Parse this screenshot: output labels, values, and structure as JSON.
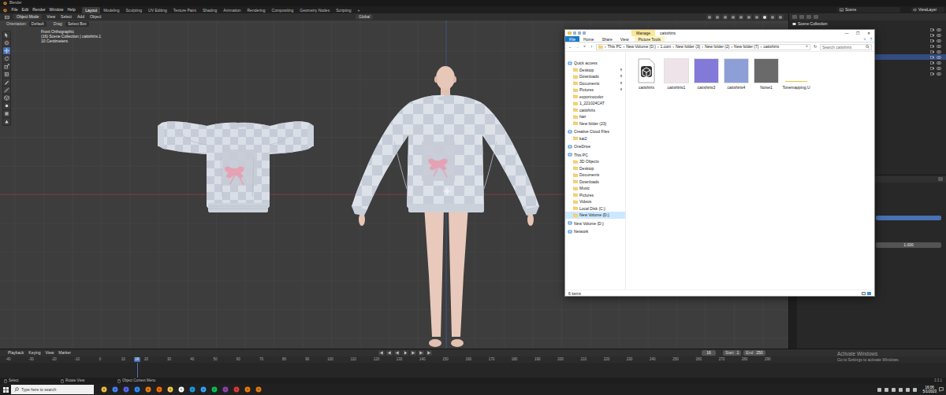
{
  "blender": {
    "title": "Blender",
    "menu": [
      "File",
      "Edit",
      "Render",
      "Window",
      "Help"
    ],
    "workspaces": [
      {
        "label": "Layout",
        "selected": true
      },
      {
        "label": "Modeling",
        "selected": false
      },
      {
        "label": "Sculpting",
        "selected": false
      },
      {
        "label": "UV Editing",
        "selected": false
      },
      {
        "label": "Texture Paint",
        "selected": false
      },
      {
        "label": "Shading",
        "selected": false
      },
      {
        "label": "Animation",
        "selected": false
      },
      {
        "label": "Rendering",
        "selected": false
      },
      {
        "label": "Compositing",
        "selected": false
      },
      {
        "label": "Geometry Nodes",
        "selected": false
      },
      {
        "label": "Scripting",
        "selected": false
      }
    ],
    "add_workspace": "+",
    "scene": "Scene",
    "view_layer": "ViewLayer",
    "header": {
      "mode": "Object Mode",
      "menus": [
        "View",
        "Select",
        "Add",
        "Object"
      ],
      "transform": "Global"
    },
    "tool_settings": {
      "orientation_label": "Orientation:",
      "orientation": "Default",
      "drag_label": "Drag:",
      "drag": "Select Box"
    },
    "viewport": {
      "info": [
        "Front Orthographic",
        "(16) Scene Collection | cattshirts.1",
        "10 Centimeters"
      ]
    },
    "tools": [
      {
        "selected": false
      },
      {
        "selected": false
      },
      {
        "selected": true
      },
      {
        "selected": false
      },
      {
        "selected": false
      },
      {
        "selected": false
      },
      {
        "selected": false
      },
      {
        "selected": false
      },
      {
        "selected": false
      },
      {
        "selected": false
      },
      {
        "selected": false
      },
      {
        "selected": false
      }
    ],
    "outliner": {
      "title": "Scene Collection",
      "rows": [
        {
          "selected": false
        },
        {
          "selected": false
        },
        {
          "selected": false
        },
        {
          "selected": false
        },
        {
          "selected": false
        },
        {
          "selected": true
        },
        {
          "selected": false
        },
        {
          "selected": false
        },
        {
          "selected": false
        }
      ]
    },
    "properties": {
      "value": "1.000"
    },
    "timeline": {
      "menus": [
        "Playback",
        "Keying",
        "View",
        "Marker"
      ],
      "current_frame": "16",
      "start_label": "Start",
      "start": "1",
      "end_label": "End",
      "end": "250",
      "ruler": [
        "-40",
        "-30",
        "-20",
        "-10",
        "0",
        "10",
        "20",
        "30",
        "40",
        "50",
        "60",
        "70",
        "80",
        "90",
        "100",
        "110",
        "120",
        "130",
        "140",
        "150",
        "160",
        "170",
        "180",
        "190",
        "200",
        "210",
        "220",
        "230",
        "240",
        "250",
        "260",
        "270",
        "280",
        "290"
      ]
    },
    "status_bar": {
      "items": [
        "Select",
        "Rotate View",
        "Object Context Menu"
      ],
      "version": "3.3.1"
    }
  },
  "explorer": {
    "title": "cattshirts",
    "context_tab": "Manage",
    "window_controls": [
      "—",
      "☐",
      "✕"
    ],
    "ribbon_tabs": [
      {
        "label": "File",
        "kind": "file"
      },
      {
        "label": "Home",
        "kind": "tab"
      },
      {
        "label": "Share",
        "kind": "tab"
      },
      {
        "label": "View",
        "kind": "tab"
      },
      {
        "label": "Picture Tools",
        "kind": "contextual"
      }
    ],
    "ribbon_right": [
      "˅",
      "?"
    ],
    "nav_buttons": [
      "←",
      "→",
      "˅",
      "↑"
    ],
    "address": {
      "path": [
        "This PC",
        "New Volume (D:)",
        "1.com",
        "New folder (3)",
        "New folder (2)",
        "New folder (7)",
        "cattshirts"
      ],
      "separator": "›",
      "dropdown": "˅",
      "refresh": "↻"
    },
    "search": {
      "placeholder": "Search cattshirts"
    },
    "nav": [
      {
        "label": "Quick access",
        "kind": "group",
        "selected": false,
        "pinned": false
      },
      {
        "label": "Desktop",
        "kind": "item",
        "selected": false,
        "pinned": true
      },
      {
        "label": "Downloads",
        "kind": "item",
        "selected": false,
        "pinned": true
      },
      {
        "label": "Documents",
        "kind": "item",
        "selected": false,
        "pinned": true
      },
      {
        "label": "Pictures",
        "kind": "item",
        "selected": false,
        "pinned": true
      },
      {
        "label": "exportnocolor",
        "kind": "item",
        "selected": false,
        "pinned": false
      },
      {
        "label": "1_221024CAT",
        "kind": "item",
        "selected": false,
        "pinned": false
      },
      {
        "label": "cattshirts",
        "kind": "item",
        "selected": false,
        "pinned": false
      },
      {
        "label": "hair",
        "kind": "item",
        "selected": false,
        "pinned": false
      },
      {
        "label": "New folder (23)",
        "kind": "item",
        "selected": false,
        "pinned": false
      },
      {
        "label": "Creative Cloud Files",
        "kind": "group",
        "selected": false,
        "pinned": false
      },
      {
        "label": "kat2",
        "kind": "item",
        "selected": false,
        "pinned": false
      },
      {
        "label": "OneDrive",
        "kind": "group",
        "selected": false,
        "pinned": false
      },
      {
        "label": "This PC",
        "kind": "group",
        "selected": false,
        "pinned": false
      },
      {
        "label": "3D Objects",
        "kind": "item",
        "selected": false,
        "pinned": false
      },
      {
        "label": "Desktop",
        "kind": "item",
        "selected": false,
        "pinned": false
      },
      {
        "label": "Documents",
        "kind": "item",
        "selected": false,
        "pinned": false
      },
      {
        "label": "Downloads",
        "kind": "item",
        "selected": false,
        "pinned": false
      },
      {
        "label": "Music",
        "kind": "item",
        "selected": false,
        "pinned": false
      },
      {
        "label": "Pictures",
        "kind": "item",
        "selected": false,
        "pinned": false
      },
      {
        "label": "Videos",
        "kind": "item",
        "selected": false,
        "pinned": false
      },
      {
        "label": "Local Disk (C:)",
        "kind": "item",
        "selected": false,
        "pinned": false
      },
      {
        "label": "New Volume (D:)",
        "kind": "item",
        "selected": true,
        "pinned": false
      },
      {
        "label": "New Volume (D:)",
        "kind": "group",
        "selected": false,
        "pinned": false
      },
      {
        "label": "Network",
        "kind": "group",
        "selected": false,
        "pinned": false
      }
    ],
    "files": [
      {
        "name": "cattshirts",
        "kind": "model",
        "color": "#ffffff"
      },
      {
        "name": "cattshirts1",
        "kind": "image",
        "color": "#efe3ea"
      },
      {
        "name": "cattshirts3",
        "kind": "image",
        "color": "#8279d9"
      },
      {
        "name": "cattshirts4",
        "kind": "image",
        "color": "#8d9fd6"
      },
      {
        "name": "Noise1",
        "kind": "image",
        "color": "#6a6a6a"
      },
      {
        "name": "Tonemapping.U",
        "kind": "pending",
        "color": "#e8c13a"
      }
    ],
    "status": "6 items"
  },
  "taskbar": {
    "search": "Type here to search",
    "time": "16:06",
    "date": "5/1/2023"
  },
  "watermark": [
    "Activate Windows",
    "Go to Settings to activate Windows."
  ]
}
